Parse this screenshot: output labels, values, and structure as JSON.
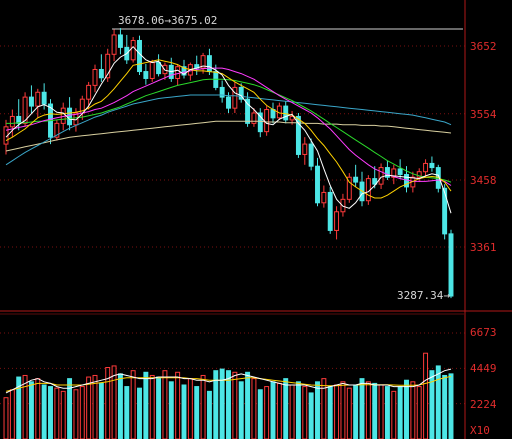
{
  "chart_data": {
    "type": "candlestick",
    "price_axis": {
      "ticks": [
        3652,
        3554,
        3458,
        3361
      ],
      "range": [
        3240,
        3700
      ]
    },
    "volume_axis": {
      "ticks": [
        6673,
        4449,
        2224
      ],
      "unit": "X10",
      "range": [
        0,
        6673
      ]
    },
    "annotations": {
      "high_label": "3678.06→3675.02",
      "low_label": "3287.34→"
    },
    "colors": {
      "up": "#ff3b3b",
      "down": "#4de6e6",
      "ma5": "#ffffff",
      "ma10": "#ffd200",
      "ma20": "#ff3cff",
      "ma30": "#2bd92b",
      "ma60": "#3aa6c9",
      "ma120": "#d9d0a0"
    },
    "candles": [
      {
        "o": 3510,
        "h": 3545,
        "l": 3495,
        "c": 3535
      },
      {
        "o": 3535,
        "h": 3560,
        "l": 3520,
        "c": 3550
      },
      {
        "o": 3550,
        "h": 3575,
        "l": 3530,
        "c": 3540
      },
      {
        "o": 3540,
        "h": 3585,
        "l": 3535,
        "c": 3578
      },
      {
        "o": 3578,
        "h": 3595,
        "l": 3555,
        "c": 3565
      },
      {
        "o": 3565,
        "h": 3590,
        "l": 3548,
        "c": 3585
      },
      {
        "o": 3585,
        "h": 3598,
        "l": 3560,
        "c": 3568
      },
      {
        "o": 3568,
        "h": 3575,
        "l": 3510,
        "c": 3520
      },
      {
        "o": 3520,
        "h": 3545,
        "l": 3515,
        "c": 3540
      },
      {
        "o": 3540,
        "h": 3570,
        "l": 3530,
        "c": 3562
      },
      {
        "o": 3562,
        "h": 3578,
        "l": 3530,
        "c": 3538
      },
      {
        "o": 3538,
        "h": 3562,
        "l": 3528,
        "c": 3555
      },
      {
        "o": 3555,
        "h": 3580,
        "l": 3545,
        "c": 3575
      },
      {
        "o": 3575,
        "h": 3600,
        "l": 3560,
        "c": 3595
      },
      {
        "o": 3595,
        "h": 3625,
        "l": 3585,
        "c": 3618
      },
      {
        "o": 3618,
        "h": 3640,
        "l": 3600,
        "c": 3606
      },
      {
        "o": 3606,
        "h": 3648,
        "l": 3600,
        "c": 3640
      },
      {
        "o": 3640,
        "h": 3676,
        "l": 3630,
        "c": 3668
      },
      {
        "o": 3668,
        "h": 3678,
        "l": 3640,
        "c": 3650
      },
      {
        "o": 3650,
        "h": 3668,
        "l": 3626,
        "c": 3632
      },
      {
        "o": 3632,
        "h": 3665,
        "l": 3628,
        "c": 3660
      },
      {
        "o": 3660,
        "h": 3667,
        "l": 3610,
        "c": 3615
      },
      {
        "o": 3615,
        "h": 3626,
        "l": 3596,
        "c": 3605
      },
      {
        "o": 3605,
        "h": 3632,
        "l": 3600,
        "c": 3628
      },
      {
        "o": 3628,
        "h": 3640,
        "l": 3608,
        "c": 3612
      },
      {
        "o": 3612,
        "h": 3628,
        "l": 3603,
        "c": 3624
      },
      {
        "o": 3624,
        "h": 3635,
        "l": 3600,
        "c": 3605
      },
      {
        "o": 3605,
        "h": 3626,
        "l": 3595,
        "c": 3622
      },
      {
        "o": 3622,
        "h": 3632,
        "l": 3605,
        "c": 3610
      },
      {
        "o": 3610,
        "h": 3628,
        "l": 3602,
        "c": 3625
      },
      {
        "o": 3625,
        "h": 3638,
        "l": 3610,
        "c": 3620
      },
      {
        "o": 3620,
        "h": 3642,
        "l": 3612,
        "c": 3638
      },
      {
        "o": 3638,
        "h": 3648,
        "l": 3610,
        "c": 3615
      },
      {
        "o": 3615,
        "h": 3625,
        "l": 3588,
        "c": 3592
      },
      {
        "o": 3592,
        "h": 3602,
        "l": 3570,
        "c": 3578
      },
      {
        "o": 3578,
        "h": 3585,
        "l": 3555,
        "c": 3562
      },
      {
        "o": 3562,
        "h": 3600,
        "l": 3555,
        "c": 3592
      },
      {
        "o": 3592,
        "h": 3598,
        "l": 3570,
        "c": 3575
      },
      {
        "o": 3575,
        "h": 3585,
        "l": 3535,
        "c": 3540
      },
      {
        "o": 3540,
        "h": 3562,
        "l": 3535,
        "c": 3555
      },
      {
        "o": 3555,
        "h": 3562,
        "l": 3520,
        "c": 3528
      },
      {
        "o": 3528,
        "h": 3565,
        "l": 3522,
        "c": 3560
      },
      {
        "o": 3560,
        "h": 3570,
        "l": 3540,
        "c": 3548
      },
      {
        "o": 3548,
        "h": 3570,
        "l": 3545,
        "c": 3565
      },
      {
        "o": 3565,
        "h": 3572,
        "l": 3540,
        "c": 3545
      },
      {
        "o": 3545,
        "h": 3558,
        "l": 3538,
        "c": 3550
      },
      {
        "o": 3550,
        "h": 3555,
        "l": 3490,
        "c": 3495
      },
      {
        "o": 3495,
        "h": 3520,
        "l": 3480,
        "c": 3510
      },
      {
        "o": 3510,
        "h": 3518,
        "l": 3472,
        "c": 3478
      },
      {
        "o": 3478,
        "h": 3490,
        "l": 3420,
        "c": 3425
      },
      {
        "o": 3425,
        "h": 3450,
        "l": 3418,
        "c": 3440
      },
      {
        "o": 3440,
        "h": 3448,
        "l": 3380,
        "c": 3385
      },
      {
        "o": 3385,
        "h": 3420,
        "l": 3372,
        "c": 3412
      },
      {
        "o": 3412,
        "h": 3438,
        "l": 3405,
        "c": 3430
      },
      {
        "o": 3430,
        "h": 3468,
        "l": 3425,
        "c": 3462
      },
      {
        "o": 3462,
        "h": 3480,
        "l": 3448,
        "c": 3455
      },
      {
        "o": 3455,
        "h": 3470,
        "l": 3420,
        "c": 3428
      },
      {
        "o": 3428,
        "h": 3465,
        "l": 3422,
        "c": 3460
      },
      {
        "o": 3460,
        "h": 3478,
        "l": 3446,
        "c": 3452
      },
      {
        "o": 3452,
        "h": 3482,
        "l": 3445,
        "c": 3476
      },
      {
        "o": 3476,
        "h": 3486,
        "l": 3458,
        "c": 3462
      },
      {
        "o": 3462,
        "h": 3480,
        "l": 3452,
        "c": 3474
      },
      {
        "o": 3474,
        "h": 3488,
        "l": 3460,
        "c": 3466
      },
      {
        "o": 3466,
        "h": 3478,
        "l": 3440,
        "c": 3448
      },
      {
        "o": 3448,
        "h": 3470,
        "l": 3440,
        "c": 3462
      },
      {
        "o": 3462,
        "h": 3475,
        "l": 3455,
        "c": 3470
      },
      {
        "o": 3470,
        "h": 3488,
        "l": 3462,
        "c": 3482
      },
      {
        "o": 3482,
        "h": 3492,
        "l": 3470,
        "c": 3476
      },
      {
        "o": 3476,
        "h": 3480,
        "l": 3440,
        "c": 3446
      },
      {
        "o": 3446,
        "h": 3452,
        "l": 3372,
        "c": 3380
      },
      {
        "o": 3380,
        "h": 3386,
        "l": 3287,
        "c": 3290
      }
    ],
    "ma5": [
      3520,
      3530,
      3538,
      3544,
      3554,
      3564,
      3567,
      3563,
      3556,
      3555,
      3546,
      3545,
      3554,
      3565,
      3581,
      3597,
      3611,
      3627,
      3636,
      3641,
      3651,
      3641,
      3632,
      3628,
      3630,
      3617,
      3615,
      3617,
      3611,
      3618,
      3620,
      3623,
      3622,
      3617,
      3610,
      3595,
      3584,
      3580,
      3568,
      3560,
      3550,
      3540,
      3538,
      3546,
      3550,
      3553,
      3540,
      3530,
      3515,
      3500,
      3474,
      3450,
      3430,
      3420,
      3417,
      3425,
      3438,
      3441,
      3450,
      3462,
      3465,
      3464,
      3463,
      3462,
      3461,
      3460,
      3464,
      3467,
      3465,
      3440,
      3410
    ],
    "ma10": [
      3515,
      3520,
      3526,
      3532,
      3540,
      3548,
      3552,
      3554,
      3553,
      3554,
      3555,
      3556,
      3558,
      3562,
      3568,
      3572,
      3580,
      3590,
      3601,
      3612,
      3624,
      3626,
      3628,
      3630,
      3632,
      3630,
      3628,
      3625,
      3620,
      3618,
      3616,
      3616,
      3615,
      3614,
      3612,
      3606,
      3600,
      3595,
      3590,
      3585,
      3575,
      3566,
      3560,
      3555,
      3554,
      3552,
      3546,
      3540,
      3530,
      3518,
      3508,
      3496,
      3484,
      3470,
      3455,
      3448,
      3442,
      3436,
      3432,
      3432,
      3436,
      3442,
      3448,
      3452,
      3456,
      3460,
      3462,
      3463,
      3462,
      3455,
      3442
    ],
    "ma20": [
      3530,
      3532,
      3534,
      3536,
      3538,
      3541,
      3544,
      3546,
      3548,
      3550,
      3552,
      3553,
      3555,
      3557,
      3560,
      3562,
      3566,
      3570,
      3575,
      3580,
      3586,
      3590,
      3594,
      3598,
      3602,
      3606,
      3610,
      3612,
      3614,
      3616,
      3618,
      3619,
      3620,
      3620,
      3620,
      3618,
      3615,
      3612,
      3608,
      3604,
      3598,
      3592,
      3586,
      3580,
      3575,
      3570,
      3565,
      3560,
      3555,
      3548,
      3540,
      3532,
      3522,
      3512,
      3502,
      3494,
      3487,
      3480,
      3474,
      3470,
      3466,
      3463,
      3460,
      3458,
      3456,
      3456,
      3456,
      3457,
      3458,
      3456,
      3450
    ],
    "ma30": [
      3540,
      3540,
      3541,
      3541,
      3542,
      3543,
      3543,
      3544,
      3545,
      3546,
      3547,
      3548,
      3549,
      3551,
      3553,
      3555,
      3558,
      3561,
      3564,
      3568,
      3572,
      3576,
      3580,
      3583,
      3586,
      3589,
      3592,
      3595,
      3597,
      3599,
      3601,
      3603,
      3604,
      3604,
      3604,
      3603,
      3602,
      3600,
      3598,
      3596,
      3593,
      3589,
      3585,
      3581,
      3577,
      3573,
      3568,
      3563,
      3558,
      3552,
      3546,
      3540,
      3534,
      3528,
      3522,
      3516,
      3510,
      3504,
      3498,
      3492,
      3486,
      3481,
      3476,
      3471,
      3467,
      3464,
      3462,
      3461,
      3460,
      3458,
      3455
    ],
    "ma60": [
      3480,
      3486,
      3492,
      3498,
      3503,
      3508,
      3513,
      3518,
      3523,
      3528,
      3533,
      3537,
      3541,
      3545,
      3549,
      3552,
      3556,
      3559,
      3562,
      3565,
      3568,
      3570,
      3572,
      3574,
      3576,
      3577,
      3578,
      3579,
      3580,
      3581,
      3581,
      3581,
      3581,
      3581,
      3581,
      3580,
      3580,
      3579,
      3578,
      3577,
      3576,
      3575,
      3574,
      3573,
      3572,
      3571,
      3570,
      3569,
      3568,
      3567,
      3566,
      3565,
      3564,
      3563,
      3562,
      3561,
      3560,
      3559,
      3558,
      3557,
      3556,
      3555,
      3554,
      3553,
      3552,
      3550,
      3548,
      3546,
      3544,
      3542,
      3538
    ],
    "ma120": [
      3500,
      3502,
      3504,
      3506,
      3508,
      3510,
      3512,
      3514,
      3516,
      3518,
      3520,
      3521,
      3522,
      3523,
      3524,
      3525,
      3526,
      3527,
      3528,
      3529,
      3530,
      3531,
      3532,
      3533,
      3534,
      3535,
      3536,
      3537,
      3538,
      3539,
      3540,
      3541,
      3542,
      3543,
      3543,
      3543,
      3543,
      3543,
      3543,
      3543,
      3543,
      3542,
      3542,
      3542,
      3541,
      3541,
      3541,
      3540,
      3540,
      3540,
      3539,
      3539,
      3539,
      3538,
      3538,
      3538,
      3537,
      3537,
      3537,
      3536,
      3536,
      3535,
      3534,
      3533,
      3532,
      3531,
      3530,
      3529,
      3528,
      3527,
      3526
    ],
    "volume": [
      2600,
      3100,
      3900,
      4000,
      3600,
      3800,
      3400,
      3300,
      3200,
      3000,
      3800,
      3100,
      3300,
      3900,
      4000,
      3500,
      4500,
      4600,
      4100,
      3300,
      4300,
      3200,
      4200,
      4000,
      3900,
      4300,
      3600,
      4200,
      3400,
      3800,
      3300,
      4000,
      3000,
      4300,
      4400,
      4300,
      4200,
      3600,
      4200,
      3800,
      3100,
      3300,
      3600,
      3500,
      3800,
      3400,
      3600,
      3300,
      2900,
      3600,
      3800,
      3300,
      3400,
      3600,
      3200,
      3400,
      3800,
      3600,
      3500,
      3400,
      3300,
      3000,
      3300,
      3700,
      3600,
      3300,
      5400,
      4300,
      4600,
      4000,
      4100
    ],
    "vol_ma5": [
      2900,
      3100,
      3300,
      3500,
      3700,
      3800,
      3600,
      3500,
      3300,
      3200,
      3200,
      3300,
      3400,
      3500,
      3600,
      3700,
      3800,
      4000,
      4100,
      4000,
      3900,
      3800,
      3800,
      3800,
      3900,
      3900,
      3900,
      3900,
      3800,
      3800,
      3700,
      3700,
      3600,
      3700,
      3700,
      3800,
      4000,
      4100,
      4000,
      3900,
      3800,
      3700,
      3600,
      3500,
      3400,
      3400,
      3400,
      3400,
      3300,
      3200,
      3200,
      3300,
      3400,
      3500,
      3400,
      3400,
      3500,
      3500,
      3400,
      3400,
      3400,
      3300,
      3300,
      3300,
      3300,
      3400,
      3700,
      3900,
      4100,
      4300,
      4400
    ],
    "vol_ma10": [
      3000,
      3100,
      3200,
      3300,
      3400,
      3500,
      3500,
      3500,
      3400,
      3400,
      3400,
      3400,
      3400,
      3450,
      3500,
      3550,
      3600,
      3700,
      3800,
      3850,
      3850,
      3850,
      3850,
      3850,
      3850,
      3850,
      3850,
      3850,
      3850,
      3800,
      3800,
      3750,
      3700,
      3700,
      3700,
      3700,
      3750,
      3800,
      3850,
      3850,
      3800,
      3750,
      3700,
      3650,
      3600,
      3550,
      3500,
      3450,
      3400,
      3380,
      3360,
      3350,
      3350,
      3380,
      3400,
      3400,
      3420,
      3420,
      3420,
      3420,
      3420,
      3400,
      3380,
      3380,
      3380,
      3400,
      3500,
      3600,
      3750,
      3850,
      3950
    ]
  }
}
